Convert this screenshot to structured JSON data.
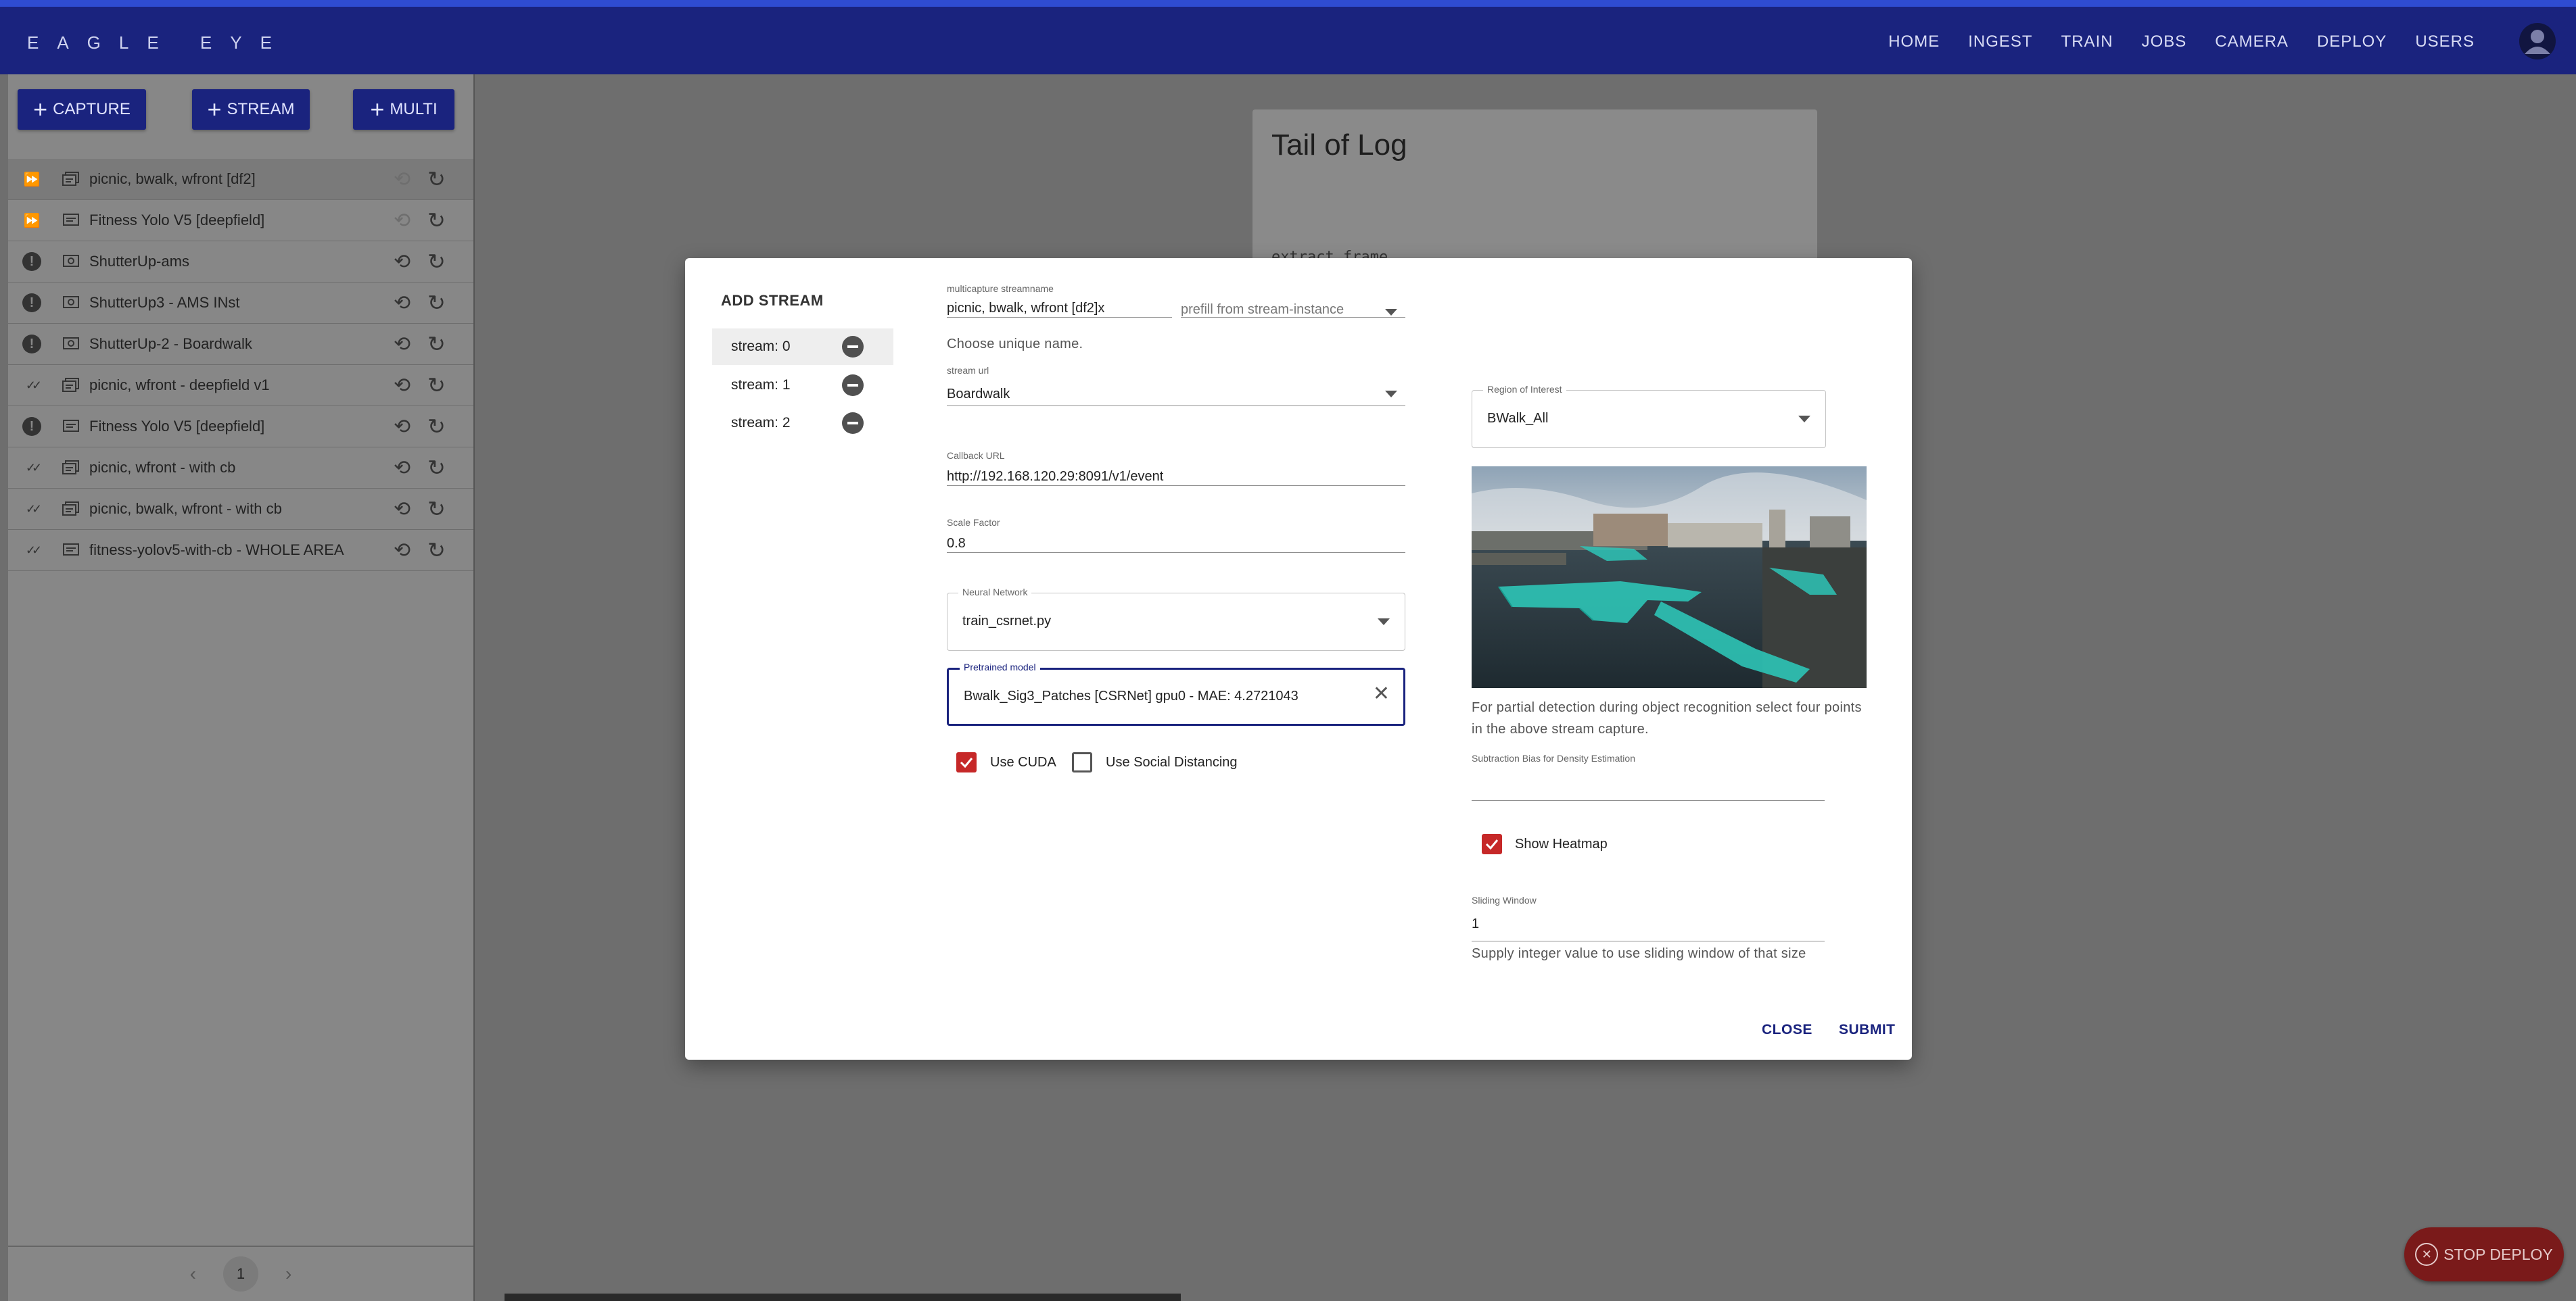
{
  "app": {
    "logo": "EAGLE EYE",
    "nav": [
      "HOME",
      "INGEST",
      "TRAIN",
      "JOBS",
      "CAMERA",
      "DEPLOY",
      "USERS"
    ]
  },
  "toolbar": {
    "capture_label": "CAPTURE",
    "stream_label": "STREAM",
    "multi_label": "MULTI"
  },
  "streams": [
    {
      "status": "forward",
      "name": "picnic, bwalk, wfront [df2]",
      "type_icon": "multi-stream-icon"
    },
    {
      "status": "forward",
      "name": "Fitness Yolo V5 [deepfield]",
      "type_icon": "stream-icon"
    },
    {
      "status": "error",
      "name": "ShutterUp-ams",
      "type_icon": "capture-icon"
    },
    {
      "status": "error",
      "name": "ShutterUp3 - AMS INst",
      "type_icon": "capture-icon"
    },
    {
      "status": "error",
      "name": "ShutterUp-2 - Boardwalk",
      "type_icon": "capture-icon"
    },
    {
      "status": "done",
      "name": "picnic, wfront - deepfield v1",
      "type_icon": "multi-stream-icon"
    },
    {
      "status": "error",
      "name": "Fitness Yolo V5 [deepfield]",
      "type_icon": "stream-icon"
    },
    {
      "status": "done",
      "name": "picnic, wfront - with cb",
      "type_icon": "multi-stream-icon"
    },
    {
      "status": "done",
      "name": "picnic, bwalk, wfront - with cb",
      "type_icon": "multi-stream-icon"
    },
    {
      "status": "done",
      "name": "fitness-yolov5-with-cb - WHOLE AREA",
      "type_icon": "stream-icon"
    }
  ],
  "pager": {
    "current": "1"
  },
  "log": {
    "title": "Tail of Log",
    "line": "extract frame"
  },
  "fab": {
    "label": "STOP DEPLOY"
  },
  "dialog": {
    "title": "ADD STREAM",
    "tabs": [
      "stream: 0",
      "stream: 1",
      "stream: 2"
    ],
    "streamname": {
      "label": "multicapture streamname",
      "value": "picnic, bwalk, wfront [df2]x",
      "helper": "Choose unique name."
    },
    "prefill": {
      "placeholder": "prefill from stream-instance"
    },
    "stream_url": {
      "label": "stream url",
      "value": "Boardwalk"
    },
    "callback": {
      "label": "Callback URL",
      "value": "http://192.168.120.29:8091/v1/event"
    },
    "scale": {
      "label": "Scale Factor",
      "value": "0.8"
    },
    "network": {
      "label": "Neural Network",
      "value": "train_csrnet.py"
    },
    "model": {
      "label": "Pretrained model",
      "value": "Bwalk_Sig3_Patches [CSRNet] gpu0 - MAE: 4.2721043"
    },
    "use_cuda": {
      "label": "Use CUDA",
      "checked": true
    },
    "social": {
      "label": "Use Social Distancing",
      "checked": false
    },
    "roi": {
      "label": "Region of Interest",
      "value": "BWalk_All",
      "helper": "For partial detection during object recognition select four points in the above stream capture."
    },
    "bias": {
      "label": "Subtraction Bias for Density Estimation",
      "value": ""
    },
    "heatmap": {
      "label": "Show Heatmap",
      "checked": true
    },
    "sliding": {
      "label": "Sliding Window",
      "value": "1",
      "helper": "Supply integer value to use sliding window of that size"
    },
    "close_label": "CLOSE",
    "submit_label": "SUBMIT"
  },
  "colors": {
    "primary": "#1a237e",
    "checkbox": "#c62828",
    "overlay_zone": "#2ec4b6"
  }
}
